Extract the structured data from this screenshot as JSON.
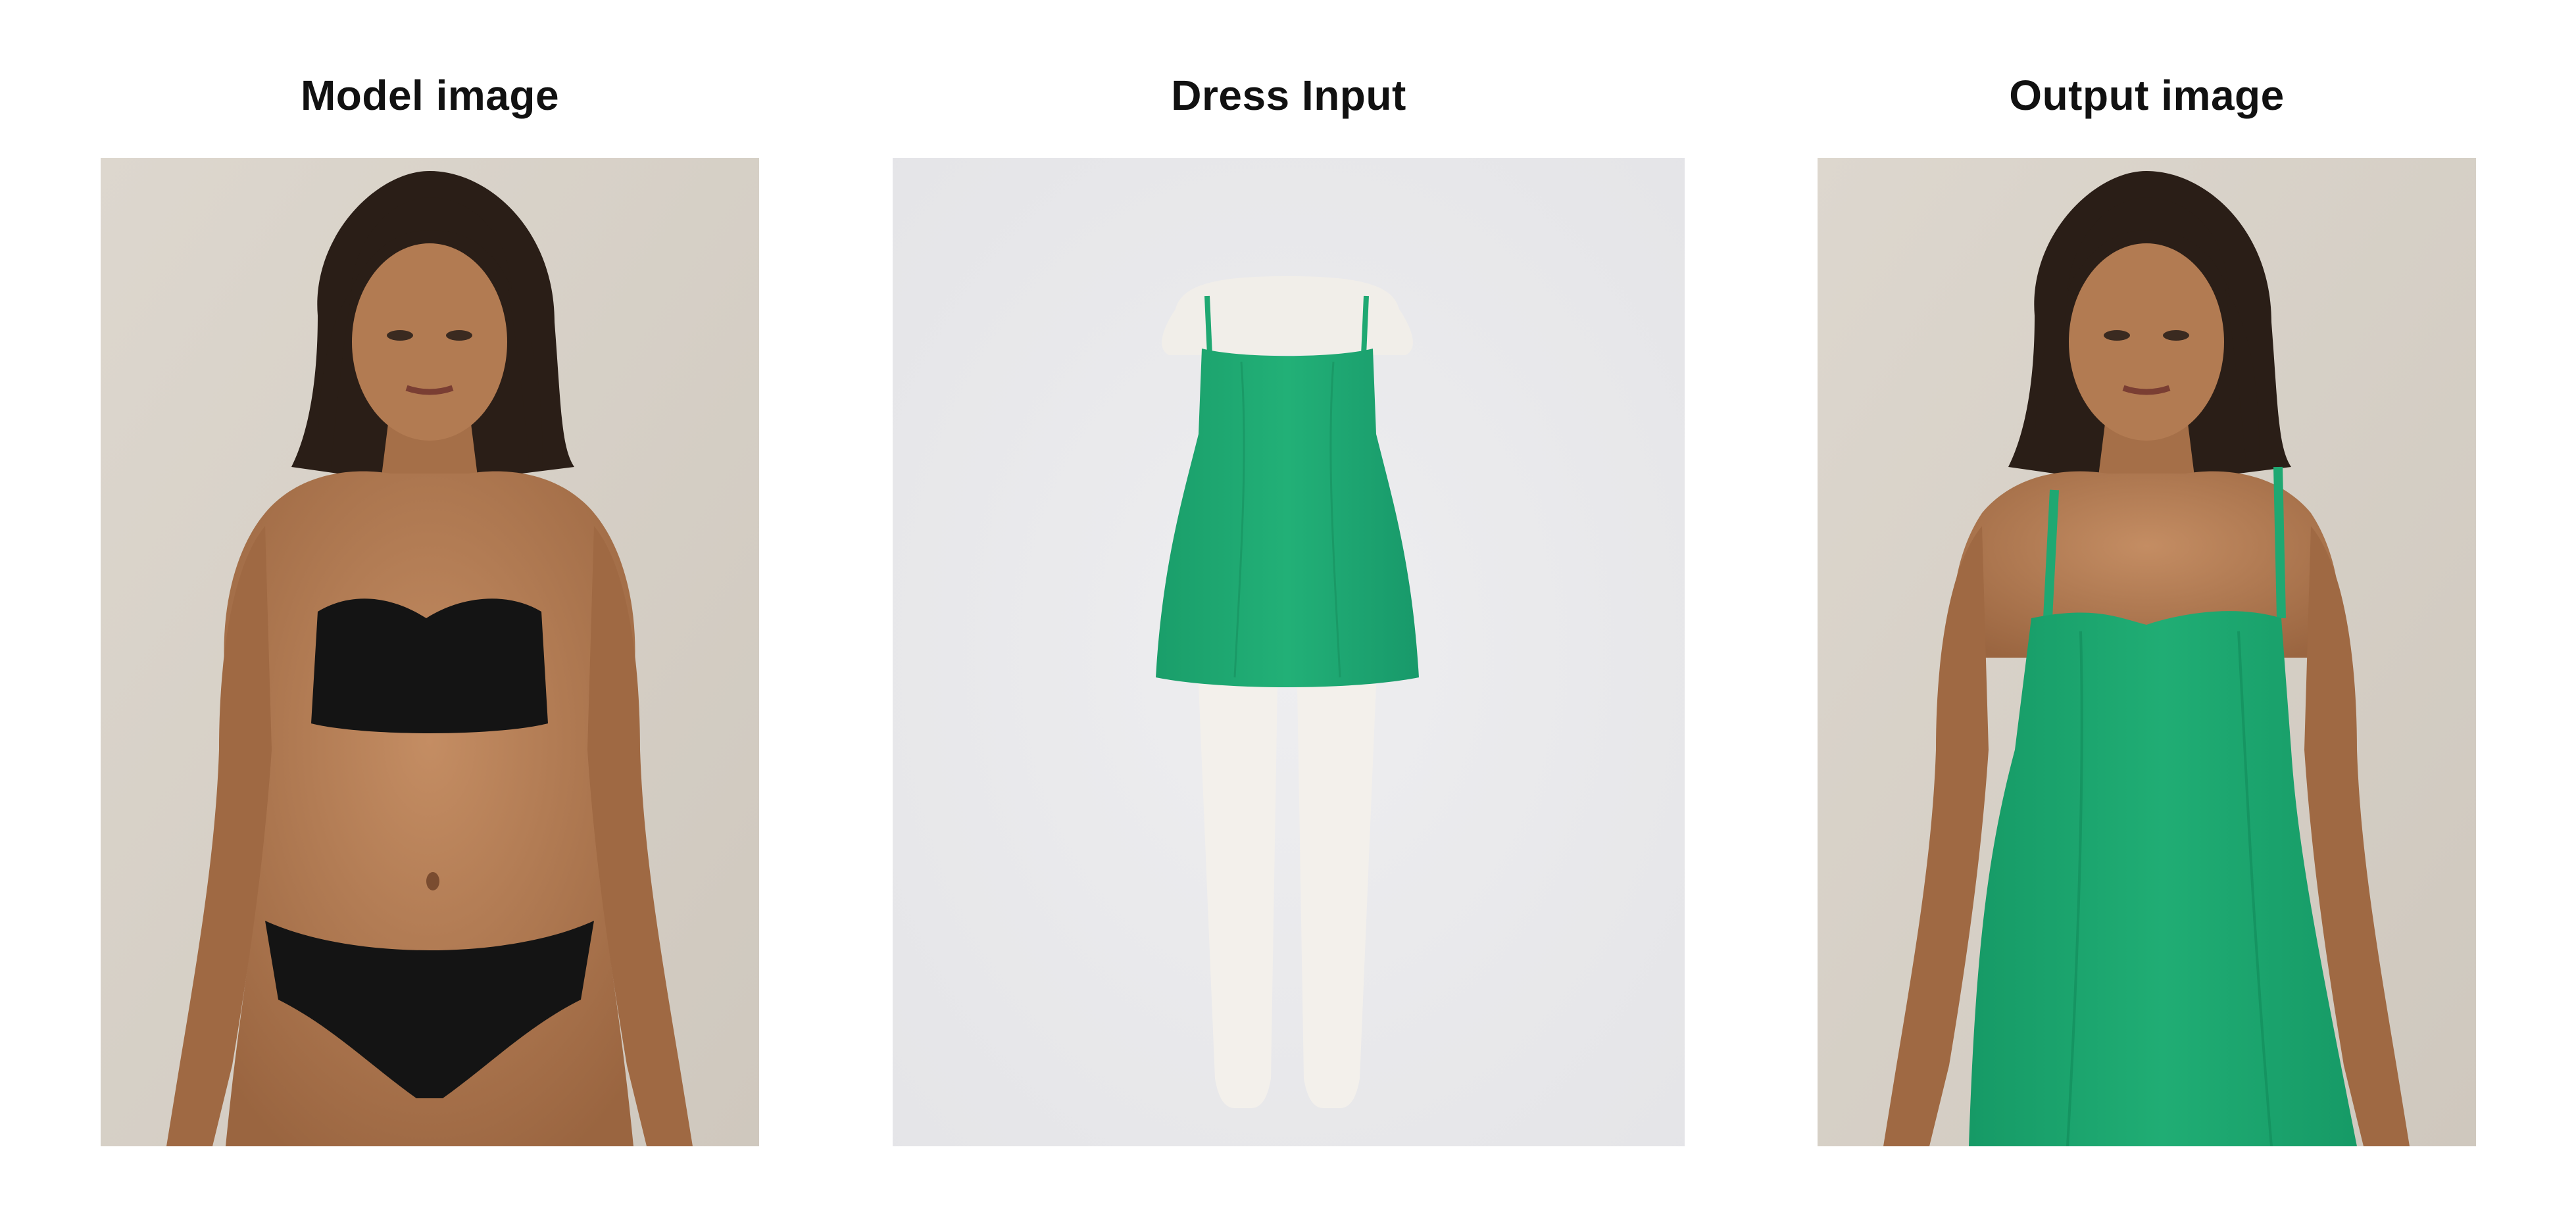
{
  "panels": {
    "model": {
      "title": "Model image"
    },
    "dress": {
      "title": "Dress Input"
    },
    "output": {
      "title": "Output image"
    }
  },
  "colors": {
    "page_background": "#ffffff",
    "photo_background_warm": "#d9d3ca",
    "photo_background_cool": "#e9e9eb",
    "dress_green": "#1fa872",
    "lingerie_black": "#141414",
    "skin": "#b07a52",
    "hair": "#2a1e17",
    "mannequin": "#f1eee9"
  },
  "icons": {
    "model_photo": "woman-in-black-lingerie-image",
    "dress_photo": "green-dress-on-mannequin-image",
    "output_photo": "woman-in-green-dress-image"
  }
}
